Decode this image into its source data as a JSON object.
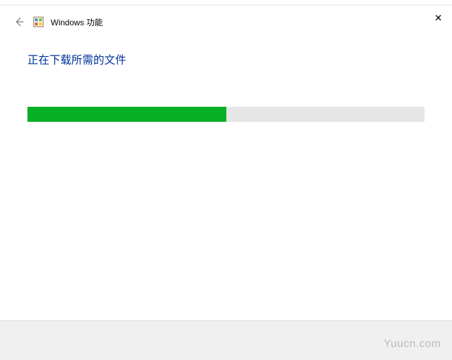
{
  "window": {
    "close_symbol": "✕",
    "title": "Windows 功能"
  },
  "content": {
    "heading": "正在下载所需的文件",
    "progress_percent": 50
  },
  "watermark": {
    "text": "Yuucn.com"
  }
}
